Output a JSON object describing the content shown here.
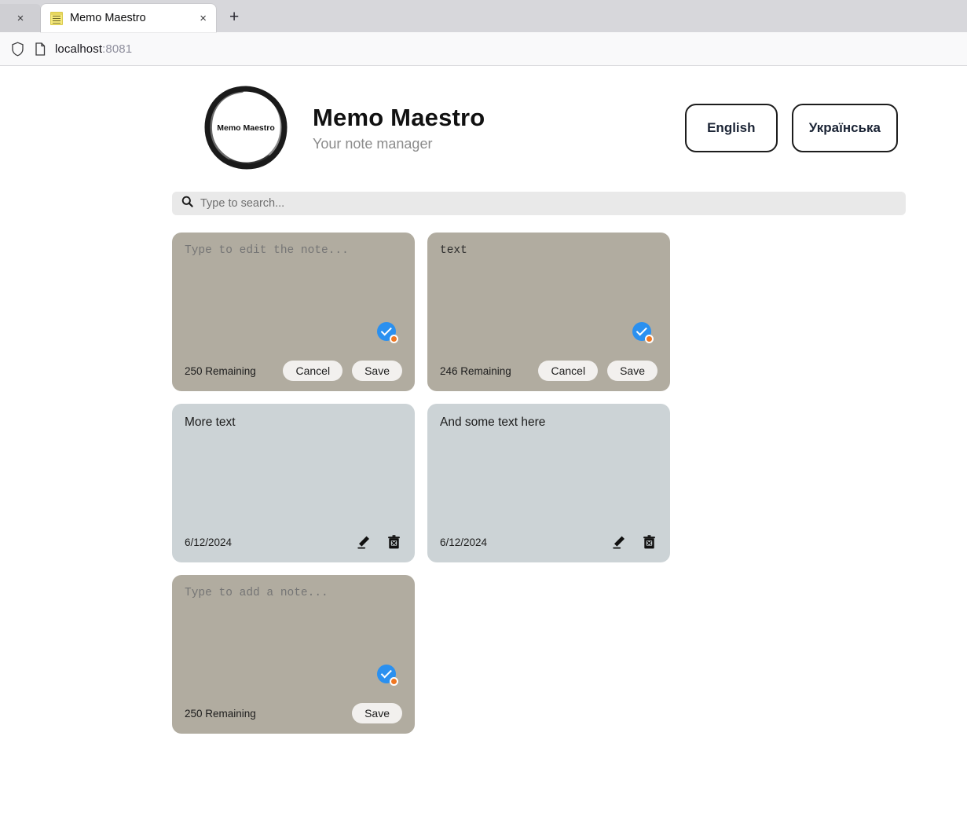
{
  "browser": {
    "ghost_tab_close": "×",
    "tab": {
      "title": "Memo Maestro",
      "favicon_name": "sticky-note-favicon",
      "close": "×"
    },
    "new_tab": "+",
    "url": "localhost",
    "url_port": ":8081"
  },
  "header": {
    "logo_text": "Memo Maestro",
    "title": "Memo Maestro",
    "subtitle": "Your note manager",
    "lang_buttons": [
      {
        "label": "English"
      },
      {
        "label": "Українська"
      }
    ]
  },
  "search": {
    "placeholder": "Type to search...",
    "value": ""
  },
  "notes": [
    {
      "mode": "edit",
      "text": "",
      "placeholder": "Type to edit the note...",
      "remaining": "250 Remaining",
      "cancel_label": "Cancel",
      "save_label": "Save",
      "has_cancel": true,
      "badge": "saved-badge"
    },
    {
      "mode": "edit",
      "text": "text",
      "placeholder": "Type to edit the note...",
      "remaining": "246 Remaining",
      "cancel_label": "Cancel",
      "save_label": "Save",
      "has_cancel": true,
      "badge": "saved-badge"
    },
    {
      "mode": "view",
      "text": "More text",
      "date": "6/12/2024",
      "edit_icon": "pencil-icon",
      "delete_icon": "trash-x-icon"
    },
    {
      "mode": "view",
      "text": "And some text here",
      "date": "6/12/2024",
      "edit_icon": "pencil-icon",
      "delete_icon": "trash-x-icon"
    },
    {
      "mode": "edit",
      "text": "",
      "placeholder": "Type to add a note...",
      "remaining": "250 Remaining",
      "save_label": "Save",
      "has_cancel": false,
      "badge": "saved-badge"
    }
  ],
  "colors": {
    "note_edit_bg": "#b1aca0",
    "note_view_bg": "#ccd3d6",
    "badge_blue": "#2a90f0",
    "badge_orange": "#ef7722",
    "button_bg": "#f2f0ee",
    "page_bg": "#ffffff"
  }
}
